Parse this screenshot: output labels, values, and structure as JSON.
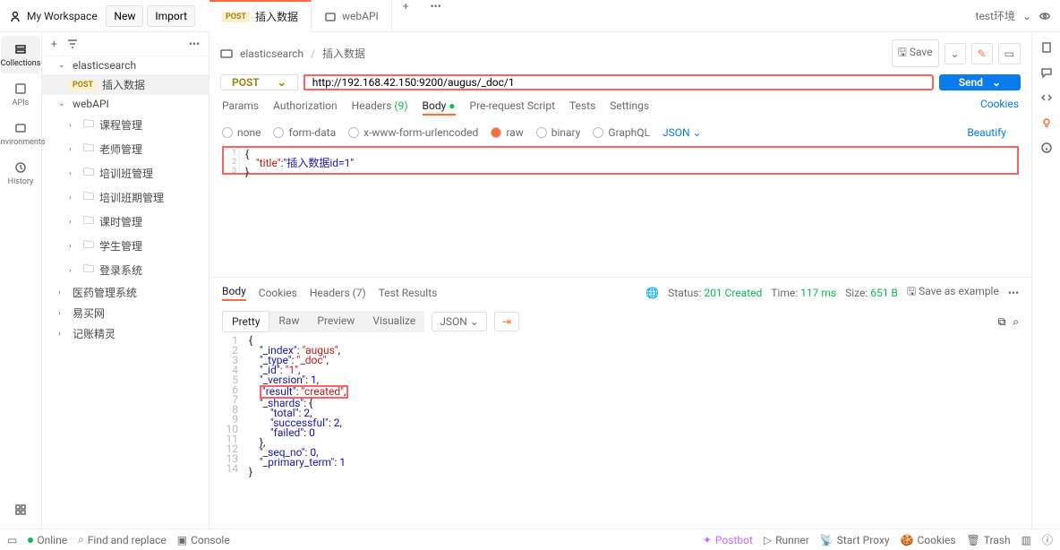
{
  "workspace": "My Workspace",
  "buttons": {
    "new": "New",
    "import": "Import",
    "save": "Save",
    "send": "Send",
    "beautify": "Beautify",
    "cookies": "Cookies",
    "saveExample": "Save as example"
  },
  "tabs": [
    {
      "method": "POST",
      "label": "插入数据",
      "active": true
    },
    {
      "icon": "api",
      "label": "webAPI",
      "active": false
    }
  ],
  "env": "test环境",
  "rail": [
    {
      "id": "collections",
      "label": "Collections"
    },
    {
      "id": "apis",
      "label": "APIs"
    },
    {
      "id": "environments",
      "label": "Environments"
    },
    {
      "id": "history",
      "label": "History"
    }
  ],
  "tree": {
    "elasticsearch": "elasticsearch",
    "elasticItem": {
      "method": "POST",
      "label": "插入数据"
    },
    "webapi": "webAPI",
    "folders": [
      "课程管理",
      "老师管理",
      "培训班管理",
      "培训班期管理",
      "课时管理",
      "学生管理",
      "登录系统"
    ],
    "roots": [
      "医药管理系统",
      "易买网",
      "记账精灵"
    ]
  },
  "crumbs": {
    "collection": "elasticsearch",
    "request": "插入数据"
  },
  "method": "POST",
  "url": "http://192.168.42.150:9200/augus/_doc/1",
  "reqTabs": {
    "params": "Params",
    "auth": "Authorization",
    "headers": "Headers",
    "headersCount": "(9)",
    "body": "Body",
    "prereq": "Pre-request Script",
    "tests": "Tests",
    "settings": "Settings"
  },
  "bodyTypes": {
    "none": "none",
    "formdata": "form-data",
    "urlenc": "x-www-form-urlencoded",
    "raw": "raw",
    "binary": "binary",
    "graphql": "GraphQL",
    "json": "JSON"
  },
  "reqBody": {
    "line1": "{",
    "line2a": "\"title\"",
    "line2b": ":",
    "line2c": "\"插入数据id=1\"",
    "line3": "}"
  },
  "respTabs": {
    "body": "Body",
    "cookies": "Cookies",
    "headers": "Headers",
    "headersCount": "(7)",
    "tests": "Test Results"
  },
  "respMeta": {
    "statusLbl": "Status:",
    "status": "201 Created",
    "timeLbl": "Time:",
    "time": "117 ms",
    "sizeLbl": "Size:",
    "size": "651 B"
  },
  "respViews": {
    "pretty": "Pretty",
    "raw": "Raw",
    "preview": "Preview",
    "visualize": "Visualize",
    "json": "JSON"
  },
  "response": {
    "l1": "{",
    "l2": {
      "k": "\"_index\"",
      "v": "\"augus\""
    },
    "l3": {
      "k": "\"_type\"",
      "v": "\"_doc\""
    },
    "l4": {
      "k": "\"_id\"",
      "v": "\"1\""
    },
    "l5": {
      "k": "\"_version\"",
      "v": "1"
    },
    "l6": {
      "k": "\"result\"",
      "v": "\"created\""
    },
    "l7": {
      "k": "\"_shards\"",
      "v": "{"
    },
    "l8": {
      "k": "\"total\"",
      "v": "2"
    },
    "l9": {
      "k": "\"successful\"",
      "v": "2"
    },
    "l10": {
      "k": "\"failed\"",
      "v": "0"
    },
    "l11": "}",
    "l12": {
      "k": "\"_seq_no\"",
      "v": "0"
    },
    "l13": {
      "k": "\"_primary_term\"",
      "v": "1"
    },
    "l14": "}"
  },
  "footer": {
    "online": "Online",
    "find": "Find and replace",
    "console": "Console",
    "postbot": "Postbot",
    "runner": "Runner",
    "proxy": "Start Proxy",
    "cookies": "Cookies",
    "trash": "Trash"
  }
}
